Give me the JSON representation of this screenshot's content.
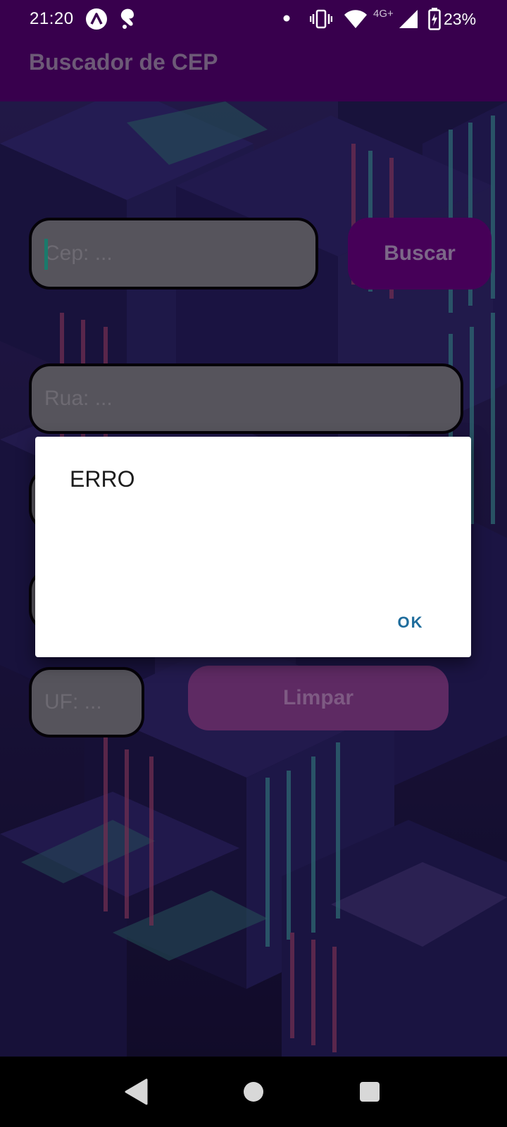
{
  "status_bar": {
    "time": "21:20",
    "network_label": "4G+",
    "battery_percent": "23%",
    "icons": [
      "app-a-icon",
      "hand-icon",
      "dot-icon",
      "vibrate-icon",
      "wifi-icon",
      "signal-icon",
      "battery-charging-icon"
    ]
  },
  "app_bar": {
    "title": "Buscador de CEP",
    "color": "#38004d"
  },
  "form": {
    "cep_placeholder": "Cep: ...",
    "rua_placeholder": "Rua: ...",
    "uf_placeholder": "UF: ...",
    "buscar_label": "Buscar",
    "limpar_label": "Limpar"
  },
  "dialog": {
    "title": "ERRO",
    "ok_label": "OK"
  },
  "nav_bar": {
    "icons": [
      "back-icon",
      "home-icon",
      "recents-icon"
    ]
  },
  "colors": {
    "primary": "#38004d",
    "dialog_button": "#1e6c9c"
  }
}
